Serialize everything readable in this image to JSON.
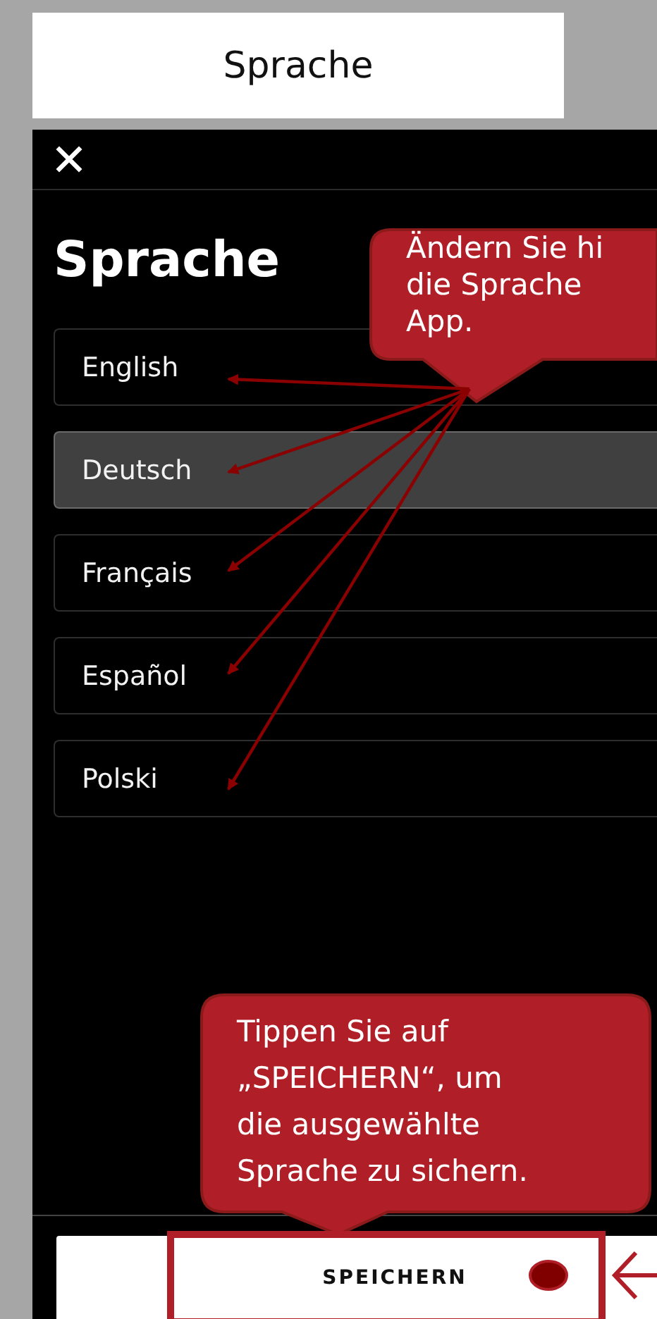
{
  "header": {
    "title": "Sprache"
  },
  "screen": {
    "heading": "Sprache",
    "languages": [
      {
        "label": "English",
        "selected": false
      },
      {
        "label": "Deutsch",
        "selected": true
      },
      {
        "label": "Français",
        "selected": false
      },
      {
        "label": "Español",
        "selected": false
      },
      {
        "label": "Polski",
        "selected": false
      }
    ],
    "save_button": "SPEICHERN"
  },
  "callout_top": {
    "lines": [
      "Ändern Sie hi",
      "die Sprache",
      "App."
    ]
  },
  "callout_bottom": {
    "lines": [
      "Tippen Sie auf",
      "„SPEICHERN“, um",
      "die ausgewählte",
      "Sprache zu sichern."
    ]
  }
}
